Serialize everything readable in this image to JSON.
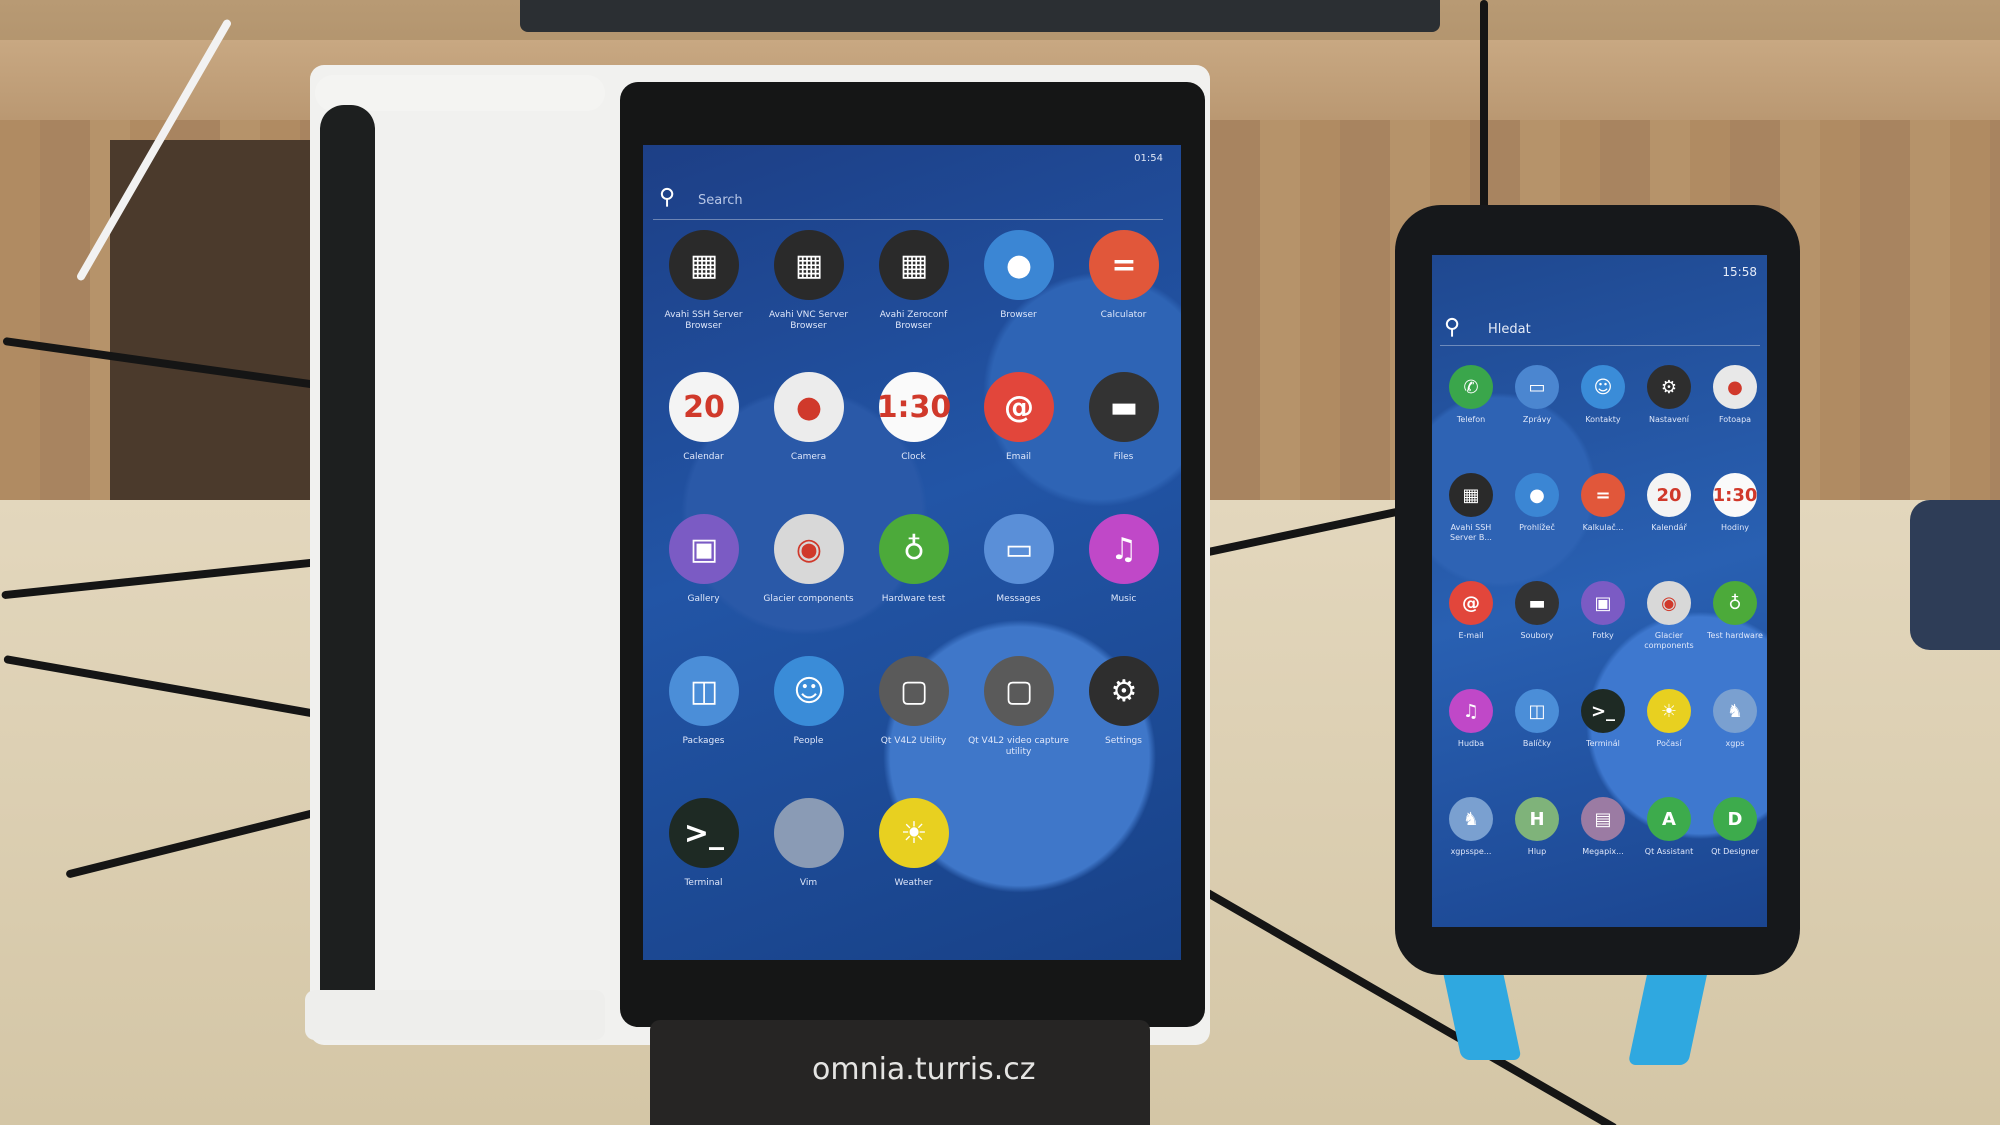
{
  "pouch_text": "omnia.turris.cz",
  "tablet": {
    "status": "01:54",
    "search_placeholder": "Search",
    "apps": [
      {
        "label": "Avahi SSH Server Browser",
        "icon": "network-icon",
        "color": "#2a2a2a",
        "glyph": "▦"
      },
      {
        "label": "Avahi VNC Server Browser",
        "icon": "network-icon",
        "color": "#2a2a2a",
        "glyph": "▦"
      },
      {
        "label": "Avahi Zeroconf Browser",
        "icon": "network-icon",
        "color": "#2a2a2a",
        "glyph": "▦"
      },
      {
        "label": "Browser",
        "icon": "globe-icon",
        "color": "#3b86d4",
        "glyph": "●"
      },
      {
        "label": "Calculator",
        "icon": "calculator-icon",
        "color": "#e1573a",
        "glyph": "="
      },
      {
        "label": "Calendar",
        "icon": "calendar-icon",
        "color": "#f4f4f4",
        "glyph": "20"
      },
      {
        "label": "Camera",
        "icon": "camera-icon",
        "color": "#ececec",
        "glyph": "●"
      },
      {
        "label": "Clock",
        "icon": "clock-icon",
        "color": "#fafafa",
        "glyph": "1:30"
      },
      {
        "label": "Email",
        "icon": "email-icon",
        "color": "#e2463b",
        "glyph": "@"
      },
      {
        "label": "Files",
        "icon": "files-icon",
        "color": "#333333",
        "glyph": "▬"
      },
      {
        "label": "Gallery",
        "icon": "gallery-icon",
        "color": "#7b5bc4",
        "glyph": "▣"
      },
      {
        "label": "Glacier components",
        "icon": "glacier-icon",
        "color": "#d8d8d8",
        "glyph": "◉"
      },
      {
        "label": "Hardware test",
        "icon": "stethoscope-icon",
        "color": "#4caa3a",
        "glyph": "♁"
      },
      {
        "label": "Messages",
        "icon": "messages-icon",
        "color": "#5a8fd8",
        "glyph": "▭"
      },
      {
        "label": "Music",
        "icon": "music-icon",
        "color": "#c048c8",
        "glyph": "♫"
      },
      {
        "label": "Packages",
        "icon": "packages-icon",
        "color": "#4b8ed8",
        "glyph": "◫"
      },
      {
        "label": "People",
        "icon": "people-icon",
        "color": "#3a8cd8",
        "glyph": "☺"
      },
      {
        "label": "Qt V4L2 Utility",
        "icon": "tv-icon",
        "color": "#5a5a5a",
        "glyph": "▢"
      },
      {
        "label": "Qt V4L2 video capture utility",
        "icon": "tv-icon",
        "color": "#5a5a5a",
        "glyph": "▢"
      },
      {
        "label": "Settings",
        "icon": "gear-icon",
        "color": "#2e2e2e",
        "glyph": "⚙"
      },
      {
        "label": "Terminal",
        "icon": "terminal-icon",
        "color": "#1e2a24",
        "glyph": ">_"
      },
      {
        "label": "Vim",
        "icon": "vim-icon",
        "color": "#8a9bb5",
        "glyph": ""
      },
      {
        "label": "Weather",
        "icon": "sun-icon",
        "color": "#e8d020",
        "glyph": "☀"
      }
    ]
  },
  "phone": {
    "status": "15:58",
    "search_placeholder": "Hledat",
    "apps": [
      {
        "label": "Telefon",
        "icon": "phone-icon",
        "color": "#3aa64b",
        "glyph": "✆"
      },
      {
        "label": "Zprávy",
        "icon": "messages-icon",
        "color": "#4b86d0",
        "glyph": "▭"
      },
      {
        "label": "Kontakty",
        "icon": "people-icon",
        "color": "#3a8cd8",
        "glyph": "☺"
      },
      {
        "label": "Nastavení",
        "icon": "gear-icon",
        "color": "#2e2e2e",
        "glyph": "⚙"
      },
      {
        "label": "Fotoapa",
        "icon": "camera-icon",
        "color": "#e8e8e8",
        "glyph": "●"
      },
      {
        "label": "Avahi SSH Server B...",
        "icon": "network-icon",
        "color": "#2a2a2a",
        "glyph": "▦"
      },
      {
        "label": "Prohlížeč",
        "icon": "globe-icon",
        "color": "#3b86d4",
        "glyph": "●"
      },
      {
        "label": "Kalkulač...",
        "icon": "calculator-icon",
        "color": "#e1573a",
        "glyph": "="
      },
      {
        "label": "Kalendář",
        "icon": "calendar-icon",
        "color": "#f4f4f4",
        "glyph": "20"
      },
      {
        "label": "Hodiny",
        "icon": "clock-icon",
        "color": "#fafafa",
        "glyph": "1:30"
      },
      {
        "label": "E-mail",
        "icon": "email-icon",
        "color": "#e2463b",
        "glyph": "@"
      },
      {
        "label": "Soubory",
        "icon": "files-icon",
        "color": "#333333",
        "glyph": "▬"
      },
      {
        "label": "Fotky",
        "icon": "gallery-icon",
        "color": "#7b5bc4",
        "glyph": "▣"
      },
      {
        "label": "Glacier components",
        "icon": "glacier-icon",
        "color": "#d8d8d8",
        "glyph": "◉"
      },
      {
        "label": "Test hardware",
        "icon": "stethoscope-icon",
        "color": "#4caa3a",
        "glyph": "♁"
      },
      {
        "label": "Hudba",
        "icon": "music-icon",
        "color": "#c048c8",
        "glyph": "♫"
      },
      {
        "label": "Balíčky",
        "icon": "packages-icon",
        "color": "#4b8ed8",
        "glyph": "◫"
      },
      {
        "label": "Terminál",
        "icon": "terminal-icon",
        "color": "#1e2a24",
        "glyph": ">_"
      },
      {
        "label": "Počasí",
        "icon": "sun-icon",
        "color": "#e8d020",
        "glyph": "☀"
      },
      {
        "label": "xgps",
        "icon": "penguin-icon",
        "color": "#7aa0d0",
        "glyph": "♞"
      },
      {
        "label": "xgpsspe...",
        "icon": "penguin-icon",
        "color": "#7aa0d0",
        "glyph": "♞"
      },
      {
        "label": "Hlup",
        "icon": "hlup-icon",
        "color": "#7fb37a",
        "glyph": "H"
      },
      {
        "label": "Megapix...",
        "icon": "megapixels-icon",
        "color": "#9b7ba3",
        "glyph": "▤"
      },
      {
        "label": "Qt Assistant",
        "icon": "qt-assistant-icon",
        "color": "#3dab4c",
        "glyph": "A"
      },
      {
        "label": "Qt Designer",
        "icon": "qt-designer-icon",
        "color": "#3dab4c",
        "glyph": "D"
      }
    ]
  }
}
